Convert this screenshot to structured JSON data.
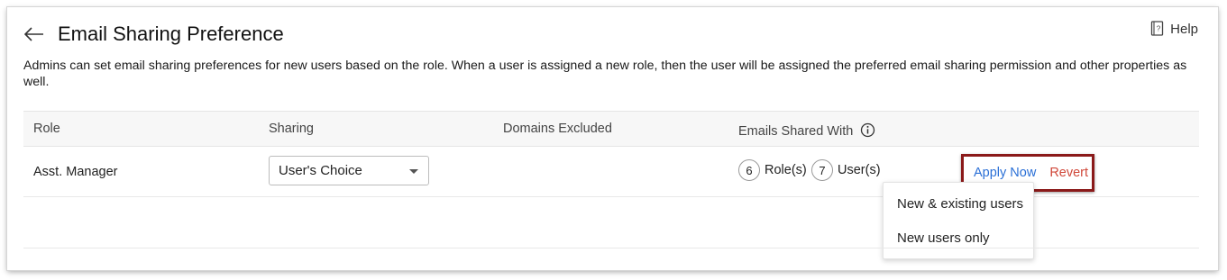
{
  "header": {
    "title": "Email Sharing Preference",
    "help_label": "Help"
  },
  "description": "Admins can set email sharing preferences for new users based on the role. When a user is assigned a new role, then the user will be assigned the preferred email sharing permission and other properties as well.",
  "table": {
    "columns": [
      "Role",
      "Sharing",
      "Domains Excluded",
      "Emails Shared With"
    ],
    "rows": [
      {
        "role": "Asst. Manager",
        "sharing": "User's Choice",
        "domains_excluded": "",
        "roles_count": "6",
        "roles_label": "Role(s)",
        "users_count": "7",
        "users_label": "User(s)"
      }
    ]
  },
  "actions": {
    "apply_label": "Apply Now",
    "revert_label": "Revert"
  },
  "apply_menu": {
    "items": [
      "New & existing users",
      "New users only"
    ]
  },
  "colors": {
    "link_blue": "#2a6fd6",
    "revert_red": "#d0483a",
    "highlight_border": "#8b1a1a"
  },
  "icons": [
    "back-arrow-icon",
    "help-book-icon",
    "info-icon",
    "chevron-down-icon"
  ]
}
